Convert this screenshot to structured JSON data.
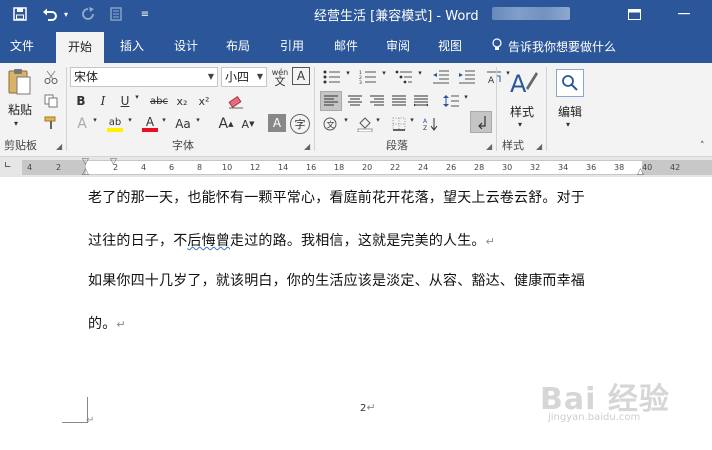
{
  "titlebar": {
    "title": "经营生活 [兼容模式] - Word",
    "icons": [
      "save-icon",
      "undo-icon",
      "undo-dropdown-icon",
      "redo-icon",
      "print-preview-icon",
      "customize-quick-access-icon"
    ],
    "window_controls": [
      "ribbon-display-options-icon",
      "minimize-icon",
      "maximize-icon",
      "close-icon"
    ]
  },
  "tabs": {
    "items": [
      "文件",
      "开始",
      "插入",
      "设计",
      "布局",
      "引用",
      "邮件",
      "审阅",
      "视图"
    ],
    "active": "开始",
    "tell_me": "告诉我你想要做什么"
  },
  "ribbon": {
    "clipboard": {
      "label": "剪贴板",
      "paste": "粘贴"
    },
    "font": {
      "label": "字体",
      "font_name": "宋体",
      "font_size": "小四",
      "bold": "B",
      "italic": "I",
      "underline": "U",
      "strike": "abc",
      "subscript": "x₂",
      "superscript": "x²",
      "grow": "A",
      "shrink": "A",
      "case": "Aa",
      "font_color": "A",
      "highlight": "ab",
      "char_shading": "A",
      "phonetic": "wén",
      "enclose": "字"
    },
    "paragraph": {
      "label": "段落"
    },
    "styles": {
      "label": "样式",
      "button": "样式"
    },
    "editing": {
      "button": "编辑"
    }
  },
  "ruler": {
    "ticks": [
      "4",
      "2",
      "2",
      "4",
      "6",
      "8",
      "10",
      "12",
      "14",
      "16",
      "18",
      "20",
      "22",
      "24",
      "26",
      "28",
      "30",
      "32",
      "34",
      "36",
      "38",
      "40",
      "42"
    ]
  },
  "document": {
    "lines": [
      {
        "text": "老了的那一天，也能怀有一颗平常心，看庭前花开花落，望天上云卷云舒。对于"
      },
      {
        "before": "过往的日子，不",
        "squiggle": "后悔曾",
        "after": "走过的路。我相信，这就是完美的人生。",
        "mark": "↵"
      },
      {
        "text": "如果你四十几岁了，就该明白，你的生活应该是淡定、从容、豁达、健康而幸福"
      },
      {
        "text": "的。",
        "mark": "↵"
      }
    ],
    "page_number": "2",
    "page_mark": "↵",
    "footer_mark": "↵"
  },
  "watermark": {
    "brand": "Bai 经验",
    "sub": "jingyan.baidu.com"
  },
  "colors": {
    "title_bar": "#2b579a",
    "ribbon": "#f3f3f3",
    "font_color_red": "#e81123",
    "highlight_yellow": "#fff200"
  }
}
